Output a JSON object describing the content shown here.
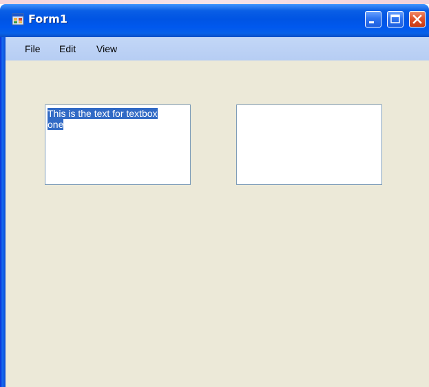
{
  "window": {
    "title": "Form1",
    "icon": "app-form-icon",
    "controls": [
      "minimize-icon",
      "maximize-icon",
      "close-icon"
    ]
  },
  "menu": {
    "items": [
      {
        "label": "File"
      },
      {
        "label": "Edit"
      },
      {
        "label": "View"
      }
    ]
  },
  "textboxes": {
    "one": {
      "value": "This is the text for textbox one",
      "line1": "This is the text for textbox",
      "line2": "one",
      "selected": true
    },
    "two": {
      "value": ""
    }
  },
  "colors": {
    "titlebar": "#0054e3",
    "menubar": "#c3d7f7",
    "client": "#ece9d8",
    "selection": "#316ac5",
    "close_button": "#e2552c"
  }
}
